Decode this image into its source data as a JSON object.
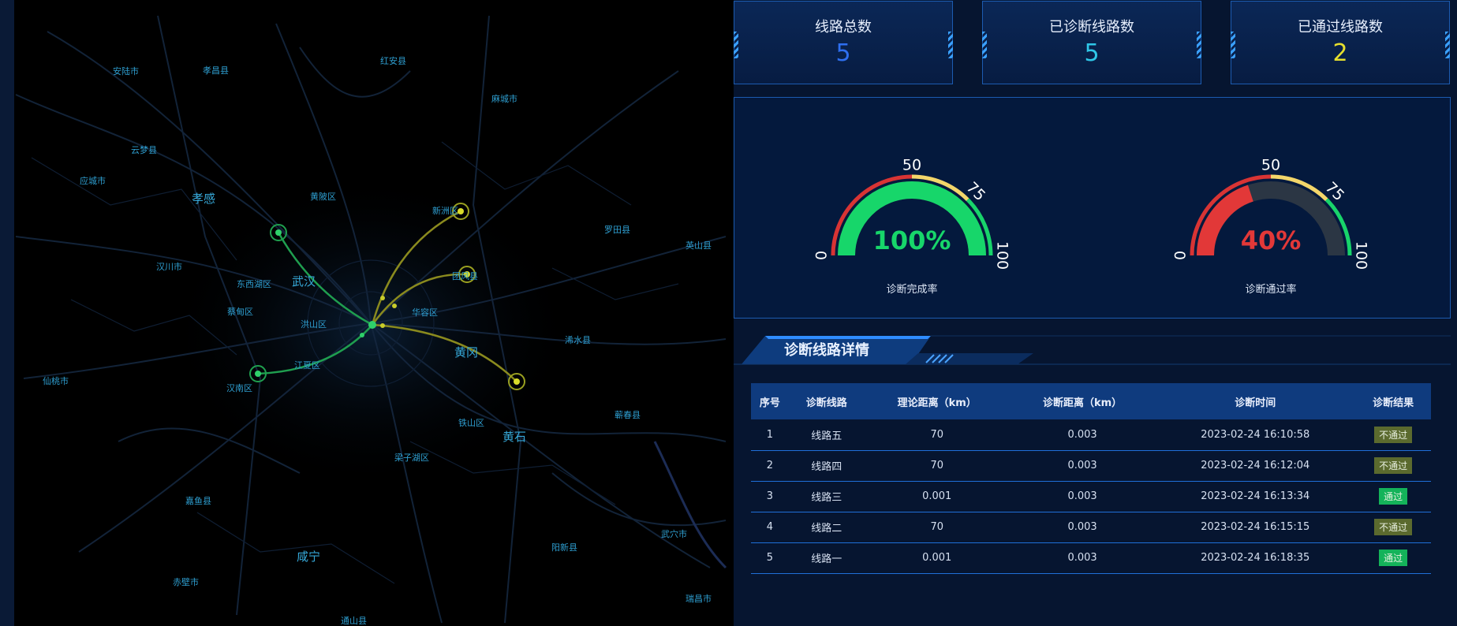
{
  "stats": [
    {
      "title": "线路总数",
      "value": "5",
      "color": "#2e6ff0"
    },
    {
      "title": "已诊断线路数",
      "value": "5",
      "color": "#2fc7e8"
    },
    {
      "title": "已通过线路数",
      "value": "2",
      "color": "#e6df2e"
    }
  ],
  "gauges": [
    {
      "label": "诊断完成率",
      "value_text": "100%",
      "value": 100,
      "color": "#17d66a",
      "ticks": {
        "t0": "0",
        "t50": "50",
        "t75": "75",
        "t100": "100"
      }
    },
    {
      "label": "诊断通过率",
      "value_text": "40%",
      "value": 40,
      "color": "#e23838",
      "ticks": {
        "t0": "0",
        "t50": "50",
        "t75": "75",
        "t100": "100"
      }
    }
  ],
  "section_title": "诊断线路详情",
  "table": {
    "headers": [
      "序号",
      "诊断线路",
      "理论距离（km）",
      "诊断距离（km）",
      "诊断时间",
      "诊断结果"
    ],
    "rows": [
      {
        "no": "1",
        "line": "线路五",
        "theory": "70",
        "diag": "0.003",
        "time": "2023-02-24 16:10:58",
        "result": "不通过",
        "status": "fail"
      },
      {
        "no": "2",
        "line": "线路四",
        "theory": "70",
        "diag": "0.003",
        "time": "2023-02-24 16:12:04",
        "result": "不通过",
        "status": "fail"
      },
      {
        "no": "3",
        "line": "线路三",
        "theory": "0.001",
        "diag": "0.003",
        "time": "2023-02-24 16:13:34",
        "result": "通过",
        "status": "pass"
      },
      {
        "no": "4",
        "line": "线路二",
        "theory": "70",
        "diag": "0.003",
        "time": "2023-02-24 16:15:15",
        "result": "不通过",
        "status": "fail"
      },
      {
        "no": "5",
        "line": "线路一",
        "theory": "0.001",
        "diag": "0.003",
        "time": "2023-02-24 16:18:35",
        "result": "通过",
        "status": "pass"
      }
    ]
  },
  "map": {
    "places": [
      {
        "name": "安陆市"
      },
      {
        "name": "孝昌县"
      },
      {
        "name": "红安县"
      },
      {
        "name": "麻城市"
      },
      {
        "name": "云梦县"
      },
      {
        "name": "应城市"
      },
      {
        "name": "孝感"
      },
      {
        "name": "黄陂区"
      },
      {
        "name": "新洲区"
      },
      {
        "name": "罗田县"
      },
      {
        "name": "英山县"
      },
      {
        "name": "汉川市"
      },
      {
        "name": "东西湖区"
      },
      {
        "name": "武汉"
      },
      {
        "name": "团风县"
      },
      {
        "name": "蔡甸区"
      },
      {
        "name": "洪山区"
      },
      {
        "name": "华容区"
      },
      {
        "name": "浠水县"
      },
      {
        "name": "黄冈"
      },
      {
        "name": "江夏区"
      },
      {
        "name": "仙桃市"
      },
      {
        "name": "汉南区"
      },
      {
        "name": "铁山区"
      },
      {
        "name": "蕲春县"
      },
      {
        "name": "黄石"
      },
      {
        "name": "梁子湖区"
      },
      {
        "name": "嘉鱼县"
      },
      {
        "name": "武穴市"
      },
      {
        "name": "阳新县"
      },
      {
        "name": "咸宁"
      },
      {
        "name": "赤壁市"
      },
      {
        "name": "瑞昌市"
      },
      {
        "name": "通山县"
      }
    ]
  }
}
